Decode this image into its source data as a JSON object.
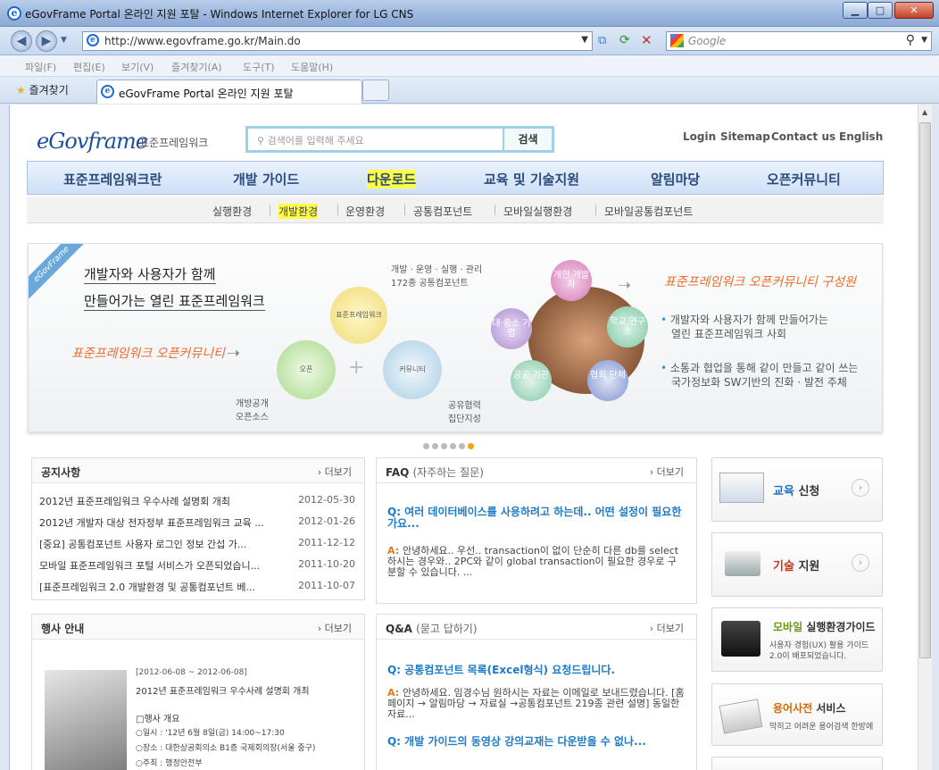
{
  "window": {
    "title": "eGovFrame Portal 온라인 지원 포탈 - Windows Internet Explorer for LG CNS"
  },
  "nav": {
    "url": "http://www.egovframe.go.kr/Main.do",
    "search_placeholder": "Google"
  },
  "menu": [
    "파일(F)",
    "편집(E)",
    "보기(V)",
    "즐겨찾기(A)",
    "도구(T)",
    "도움말(H)"
  ],
  "tabs": {
    "favorites": "즐겨찾기",
    "active": "eGovFrame Portal 온라인 지원 포탈"
  },
  "site": {
    "logo": "eGovframe",
    "logo_sub": "표준프레임워크",
    "search_placeholder": "검색어를 입력해 주세요",
    "search_button": "검색",
    "top_links": [
      "Login",
      "Sitemap",
      "Contact us",
      "English"
    ]
  },
  "gnb": [
    "표준프레임워크란",
    "개발 가이드",
    "다운로드",
    "교육 및 기술지원",
    "알림마당",
    "오픈커뮤니티"
  ],
  "subnav": [
    "실행환경",
    "개발환경",
    "운영환경",
    "공통컴포넌트",
    "모바일실행환경",
    "모바일공통컴포넌트"
  ],
  "banner": {
    "corner": "eGovFrame",
    "headline1": "개발자와 사용자가 함께",
    "headline2": "만들어가는 열린 표준프레임워크",
    "hand1": "표준프레임워크 오픈커뮤니티",
    "hand2": "표준프레임워크 오픈커뮤니티 구성원",
    "top_note1": "개발 · 운영 · 실행 · 관리",
    "top_note2": "172종 공통컴포넌트",
    "circle_fw": "표준프레임워크",
    "circle_open": "오픈",
    "circle_comm": "커뮤니티",
    "open_note1": "개방공개",
    "open_note2": "오픈소스",
    "share_note1": "공유협력",
    "share_note2": "집단지성",
    "members": [
      "개인 개발자",
      "대·중소 기업",
      "학교 연구소",
      "공공 기관",
      "협회 단체"
    ],
    "bullet1a": "개발자와 사용자가 함께 만들어가는",
    "bullet1b": "열린 표준프레임워크 사회",
    "bullet2a": "소통과 협업을 통해 같이 만들고 같이 쓰는",
    "bullet2b": "국가정보화 SW기반의 진화 · 발전 주체"
  },
  "notice": {
    "title": "공지사항",
    "more": "더보기",
    "items": [
      {
        "text": "2012년 표준프레임워크 우수사례 설명회 개최",
        "date": "2012-05-30"
      },
      {
        "text": "2012년 개발자 대상 전자정부 표준프레임워크 교육 ...",
        "date": "2012-01-26"
      },
      {
        "text": "[중요] 공통컴포넌트 사용자 로그인 정보 간섭 가...",
        "date": "2011-12-12"
      },
      {
        "text": "모바일 표준프레임워크 포털 서비스가 오픈되었습니...",
        "date": "2011-10-20"
      },
      {
        "text": "[표준프레임워크 2.0 개발환경 및 공통컴포넌트 베...",
        "date": "2011-10-07"
      }
    ]
  },
  "event": {
    "title": "행사 안내",
    "more": "더보기",
    "period": "[2012-06-08 ~ 2012-06-08]",
    "name": "2012년 표준프레임워크 우수사례 설명회 개최",
    "summary": "□행사 개요",
    "date": "○일시 : '12년 6월 8일(금) 14:00~17:30",
    "place": "○장소 : 대한상공회의소 B1층 국제회의장(서울 중구)",
    "host": "○주최 : 행정안전부"
  },
  "faq": {
    "title": "FAQ",
    "title_sub": "(자주하는 질문)",
    "more": "더보기",
    "q": "Q: 여러 데이터베이스를 사용하려고 하는데.. 어떤 설정이 필요한가요...",
    "a": "안녕하세요.. 우선.. transaction이 없이 단순히 다른 db를 select하시는 경우와.. 2PC와 같이 global transaction이 필요한 경우로 구분할 수 있습니다. ..."
  },
  "qna": {
    "title": "Q&A",
    "title_sub": "(묻고 답하기)",
    "more": "더보기",
    "q1": "Q: 공통컴포넌트 목록(Excel형식) 요청드립니다.",
    "a1": "안녕하세요. 임경수님 원하시는 자료는 이메일로 보내드렸습니다. [홈페이지 → 알림마당 → 자료실 →공통컴포넌트 219종 관련 설명] 동일한 자료...",
    "q2": "Q: 개발 가이드의 동영상 강의교재는 다운받을 수 없나..."
  },
  "quick": {
    "edu_a": "교육",
    "edu_b": "신청",
    "tech_a": "기술",
    "tech_b": "지원",
    "mobile_a": "모바일",
    "mobile_b": "실행환경가이드",
    "mobile_desc1": "사용자 경험(UX) 활용 가이드",
    "mobile_desc2": "2.0이 배포되었습니다.",
    "dict_a": "용어사전",
    "dict_b": "서비스",
    "dict_desc": "막히고 어려운 용어검색 한방에"
  }
}
